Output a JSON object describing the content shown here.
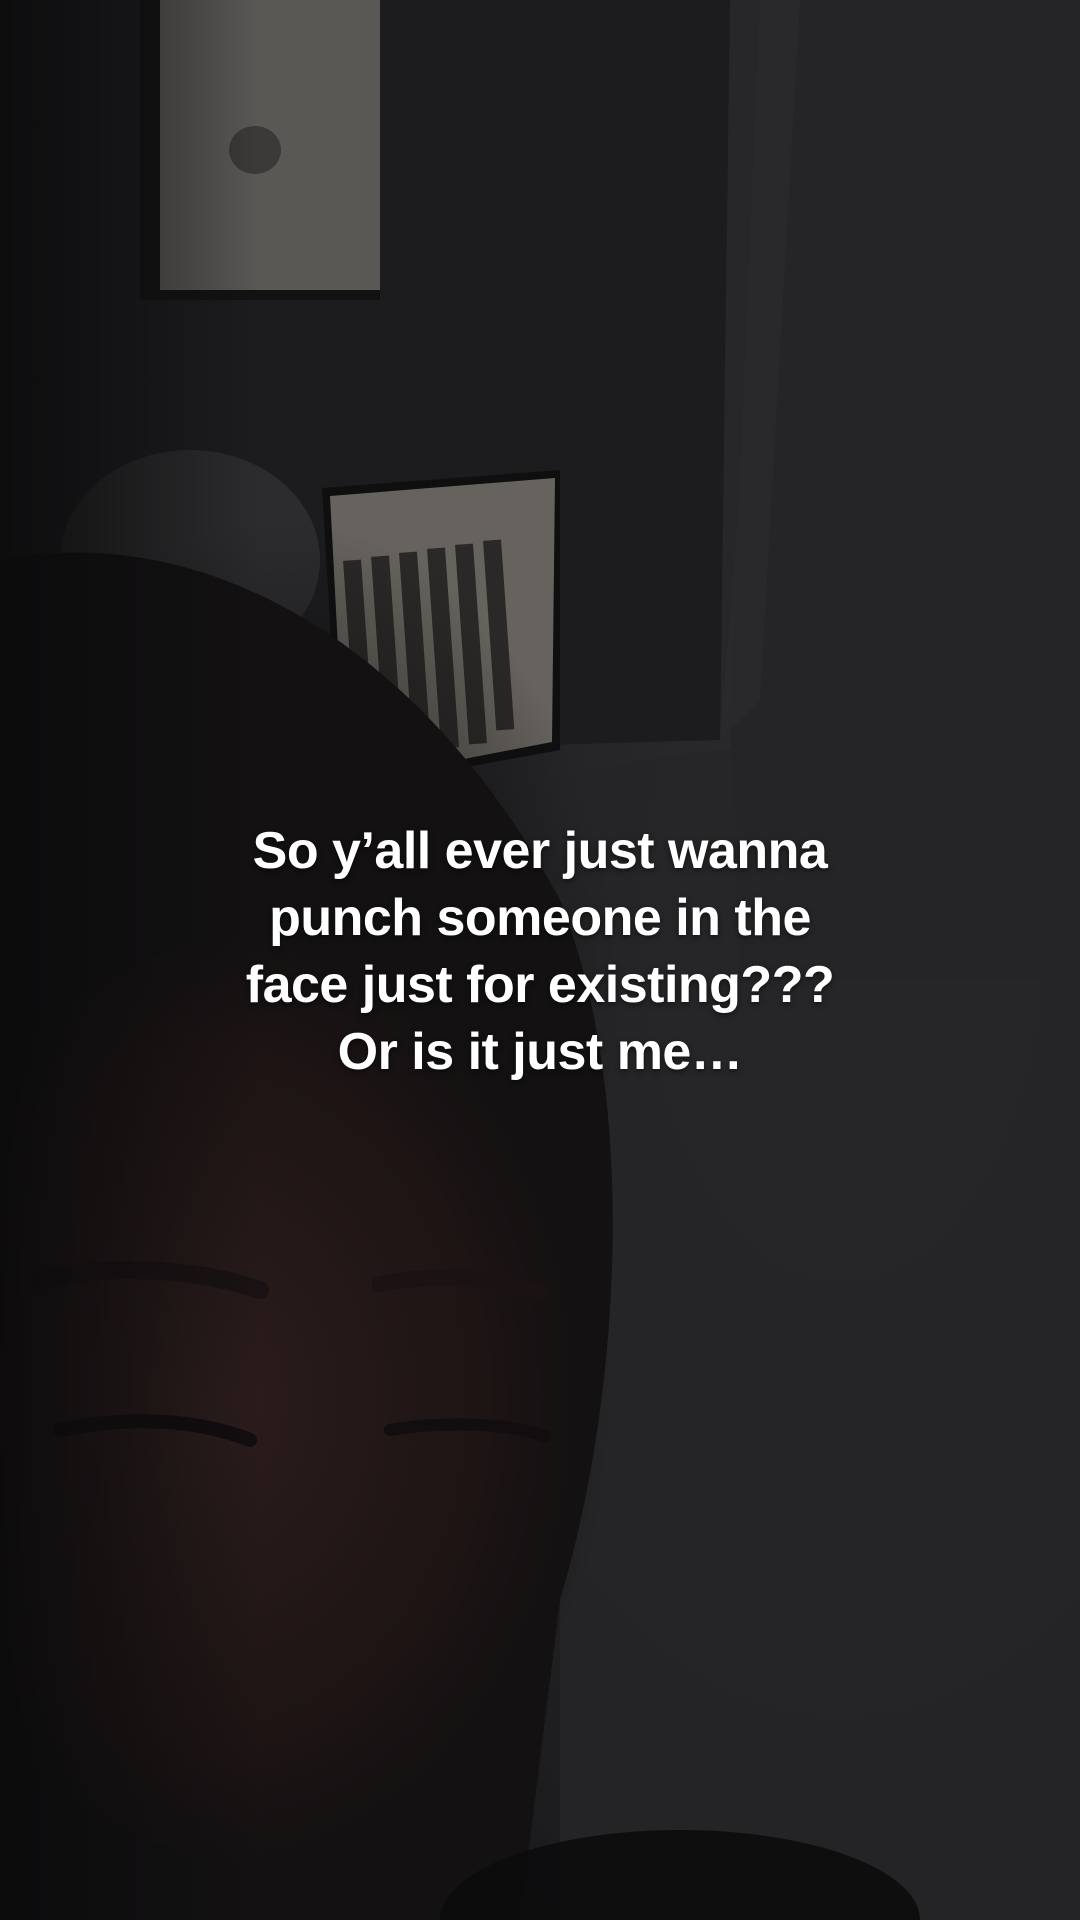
{
  "caption": {
    "lines": [
      "So y’all ever just wanna",
      "punch someone in the",
      "face just for existing???",
      "Or is it just me…"
    ]
  },
  "colors": {
    "background": "#151516",
    "wall_dark": "#1e1e21",
    "wall_light": "#2a2a2c",
    "frame_white": "#5f5d5a",
    "caption_text": "#ffffff",
    "skin_shadow": "#2a1b1a"
  },
  "scene": {
    "description_icons": [
      "wall-frame-icon",
      "wall-sign-icon",
      "person-face-icon"
    ]
  }
}
